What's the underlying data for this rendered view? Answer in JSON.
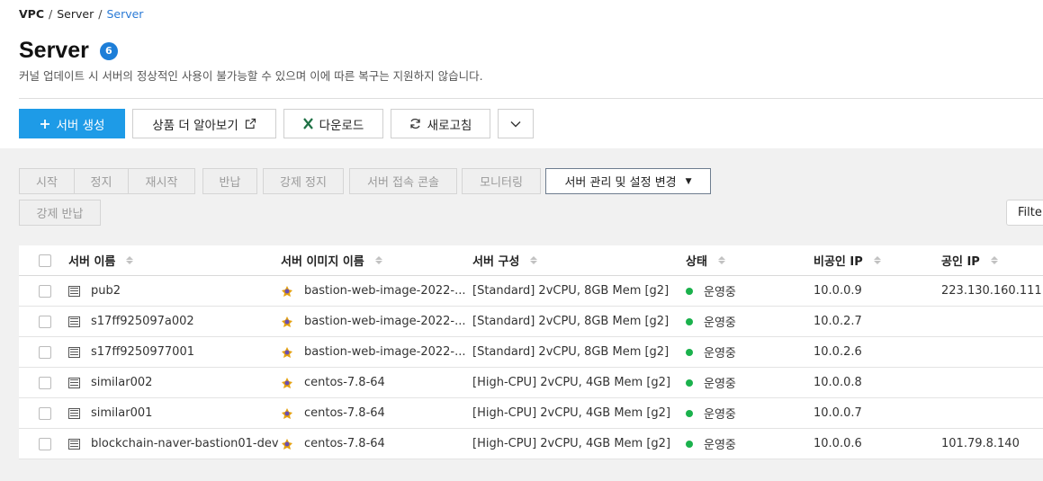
{
  "breadcrumb": [
    "VPC",
    "Server",
    "Server"
  ],
  "page": {
    "title": "Server",
    "count": "6",
    "description": "커널 업데이트 시 서버의 정상적인 사용이 불가능할 수 있으며 이에 따른 복구는 지원하지 않습니다."
  },
  "toolbar": {
    "create": "서버 생성",
    "learn_more": "상품 더 알아보기",
    "download": "다운로드",
    "refresh": "새로고침"
  },
  "actions": {
    "start": "시작",
    "stop": "정지",
    "restart": "재시작",
    "return": "반납",
    "force_stop": "강제 정지",
    "console": "서버 접속 콘솔",
    "monitoring": "모니터링",
    "manage": "서버 관리 및 설정 변경",
    "force_return": "강제 반납"
  },
  "filter": {
    "label": "Filter"
  },
  "table": {
    "headers": {
      "name": "서버 이름",
      "image": "서버 이미지 이름",
      "spec": "서버 구성",
      "state": "상태",
      "private_ip": "비공인 IP",
      "public_ip": "공인 IP"
    },
    "rows": [
      {
        "name": "pub2",
        "image": "bastion-web-image-2022-...",
        "spec": "[Standard] 2vCPU, 8GB Mem [g2]",
        "state": "운영중",
        "private_ip": "10.0.0.9",
        "public_ip": "223.130.160.111"
      },
      {
        "name": "s17ff925097a002",
        "image": "bastion-web-image-2022-...",
        "spec": "[Standard] 2vCPU, 8GB Mem [g2]",
        "state": "운영중",
        "private_ip": "10.0.2.7",
        "public_ip": ""
      },
      {
        "name": "s17ff9250977001",
        "image": "bastion-web-image-2022-...",
        "spec": "[Standard] 2vCPU, 8GB Mem [g2]",
        "state": "운영중",
        "private_ip": "10.0.2.6",
        "public_ip": ""
      },
      {
        "name": "similar002",
        "image": "centos-7.8-64",
        "spec": "[High-CPU] 2vCPU, 4GB Mem [g2]",
        "state": "운영중",
        "private_ip": "10.0.0.8",
        "public_ip": ""
      },
      {
        "name": "similar001",
        "image": "centos-7.8-64",
        "spec": "[High-CPU] 2vCPU, 4GB Mem [g2]",
        "state": "운영중",
        "private_ip": "10.0.0.7",
        "public_ip": ""
      },
      {
        "name": "blockchain-naver-bastion01-dev",
        "image": "centos-7.8-64",
        "spec": "[High-CPU] 2vCPU, 4GB Mem [g2]",
        "state": "운영중",
        "private_ip": "10.0.0.6",
        "public_ip": "101.79.8.140"
      }
    ]
  },
  "colors": {
    "primary": "#1e9be7",
    "badge": "#1d7ed8",
    "status_running": "#1ab14c",
    "excel": "#1d7044"
  }
}
